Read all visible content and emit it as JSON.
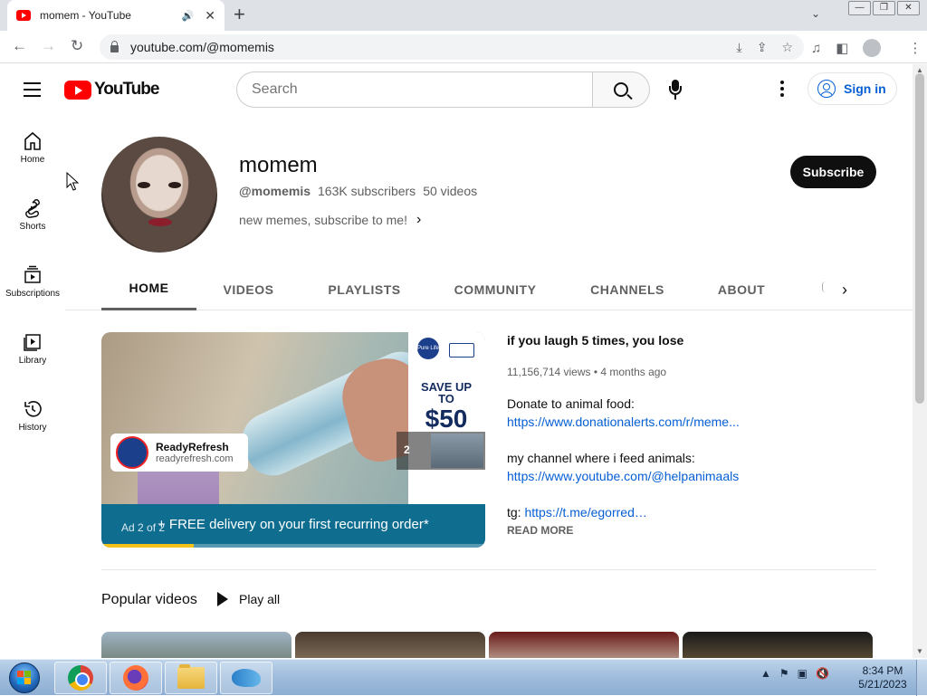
{
  "browser": {
    "tab_title": "momem - YouTube",
    "url": "youtube.com/@momemis"
  },
  "masthead": {
    "logo_text": "YouTube",
    "search_placeholder": "Search",
    "sign_in_label": "Sign in"
  },
  "guide": {
    "items": [
      {
        "label": "Home",
        "icon": "home-icon"
      },
      {
        "label": "Shorts",
        "icon": "shorts-icon"
      },
      {
        "label": "Subscriptions",
        "icon": "subscriptions-icon"
      },
      {
        "label": "Library",
        "icon": "library-icon"
      },
      {
        "label": "History",
        "icon": "history-icon"
      }
    ]
  },
  "channel": {
    "name": "momem",
    "handle": "@momemis",
    "subscribers": "163K subscribers",
    "videos": "50 videos",
    "description": "new memes, subscribe to me!",
    "subscribe_label": "Subscribe"
  },
  "tabs": [
    "HOME",
    "VIDEOS",
    "PLAYLISTS",
    "COMMUNITY",
    "CHANNELS",
    "ABOUT"
  ],
  "ad": {
    "advertiser_name": "ReadyRefresh",
    "advertiser_domain": "readyrefresh.com",
    "panel_save": "SAVE UP TO",
    "panel_amount": "$50",
    "brand_badge": "Pure Life",
    "offer": "+ FREE delivery on your first recurring order*",
    "ad_count": "Ad 2 of 2",
    "next_number": "2",
    "progress": 0.24
  },
  "featured": {
    "title": "if you laugh 5 times, you lose",
    "stats": "11,156,714 views • 4 months ago",
    "line1": "Donate to animal food:",
    "link1": "https://www.donationalerts.com/r/meme...",
    "line2": "my channel where i feed animals:",
    "link2": "https://www.youtube.com/@helpanimaals",
    "line3_prefix": "tg:",
    "link3": "https://t.me/egorred…",
    "read_more": "READ MORE"
  },
  "shelf": {
    "title": "Popular videos",
    "play_all": "Play all"
  },
  "taskbar": {
    "time": "8:34 PM",
    "date": "5/21/2023"
  },
  "colors": {
    "youtube_red": "#ff0000",
    "link_blue": "#065fd4",
    "subscribe_bg": "#0f0f0f",
    "ad_bar": "#0f6d90"
  }
}
